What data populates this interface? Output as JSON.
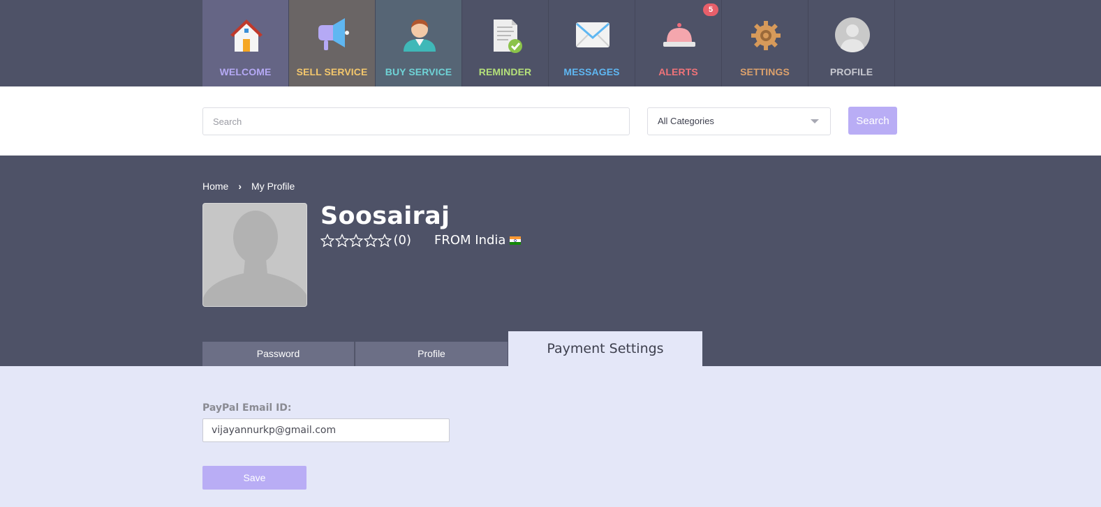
{
  "nav": {
    "items": [
      {
        "label": "WELCOME",
        "icon": "house-icon",
        "color": "#b5a9f5",
        "bg": "#656585"
      },
      {
        "label": "SELL SERVICE",
        "icon": "megaphone-icon",
        "color": "#f4c76c",
        "bg": "#6a6565"
      },
      {
        "label": "BUY SERVICE",
        "icon": "user-icon",
        "color": "#6fd3d7",
        "bg": "#566575"
      },
      {
        "label": "REMINDER",
        "icon": "document-check-icon",
        "color": "#b4e07a",
        "bg": "#4e5267"
      },
      {
        "label": "MESSAGES",
        "icon": "envelope-icon",
        "color": "#5fb7f2",
        "bg": "#4e5267"
      },
      {
        "label": "ALERTS",
        "icon": "bell-icon",
        "color": "#f07379",
        "bg": "#4e5267",
        "badge": "5"
      },
      {
        "label": "SETTINGS",
        "icon": "gear-icon",
        "color": "#dca16c",
        "bg": "#4e5267"
      },
      {
        "label": "PROFILE",
        "icon": "avatar-icon",
        "color": "#c7c8d0",
        "bg": "#4e5267"
      }
    ]
  },
  "search": {
    "placeholder": "Search",
    "category": "All Categories",
    "button": "Search"
  },
  "breadcrumb": {
    "home": "Home",
    "separator": "›",
    "current": "My Profile"
  },
  "profile": {
    "name": "Soosairaj",
    "rating_stars": 0,
    "rating_count": "(0)",
    "from": "FROM India"
  },
  "tabs": {
    "password": "Password",
    "profile": "Profile",
    "payment": "Payment Settings"
  },
  "form": {
    "paypal_label": "PayPal Email ID:",
    "paypal_value": "vijayannurkp@gmail.com",
    "save_button": "Save"
  },
  "colors": {
    "nav_bg": "#4e5267",
    "accent": "#b9adf5",
    "content_bg": "#e4e7f8"
  }
}
